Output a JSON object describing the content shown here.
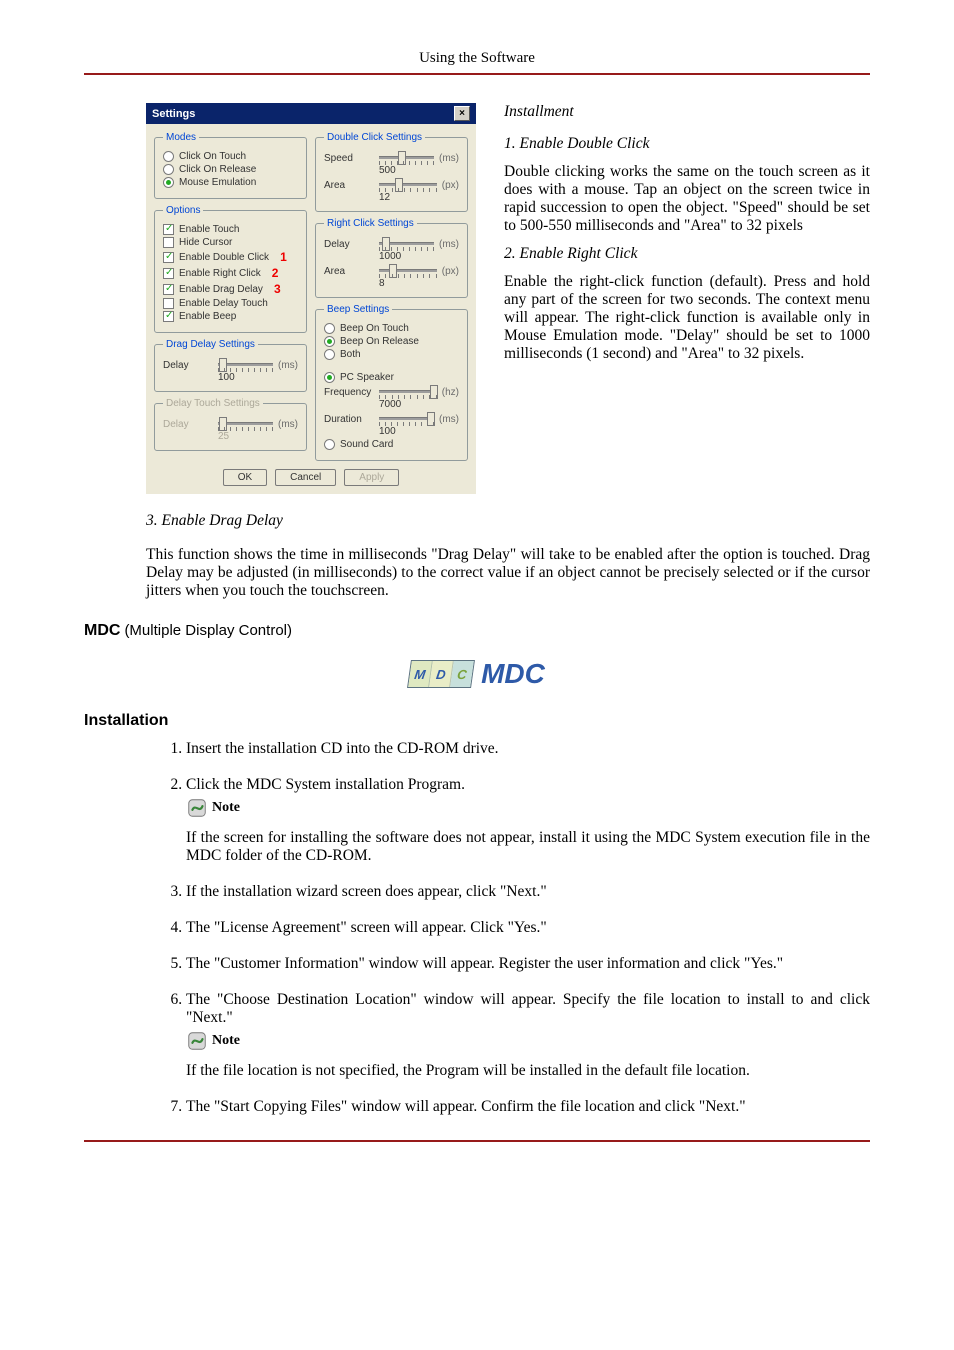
{
  "header": {
    "title": "Using the Software"
  },
  "settings_dialog": {
    "title": "Settings",
    "groups": {
      "modes": {
        "legend": "Modes",
        "click_on_touch": "Click On Touch",
        "click_on_release": "Click On Release",
        "mouse_emulation": "Mouse Emulation"
      },
      "options": {
        "legend": "Options",
        "enable_touch": "Enable Touch",
        "hide_cursor": "Hide Cursor",
        "enable_double_click": "Enable Double Click",
        "enable_right_click": "Enable Right Click",
        "enable_drag_delay": "Enable Drag Delay",
        "enable_delay_touch": "Enable Delay Touch",
        "enable_beep": "Enable Beep",
        "marker1": "1",
        "marker2": "2",
        "marker3": "3"
      },
      "drag_delay": {
        "legend": "Drag Delay Settings",
        "delay_label": "Delay",
        "delay_val": "100",
        "unit": "(ms)"
      },
      "delay_touch": {
        "legend": "Delay Touch Settings",
        "delay_label": "Delay",
        "delay_val": "25",
        "unit": "(ms)"
      },
      "double_click": {
        "legend": "Double Click Settings",
        "speed_label": "Speed",
        "speed_val": "500",
        "speed_unit": "(ms)",
        "area_label": "Area",
        "area_val": "12",
        "area_unit": "(px)"
      },
      "right_click": {
        "legend": "Right Click Settings",
        "delay_label": "Delay",
        "delay_val": "1000",
        "delay_unit": "(ms)",
        "area_label": "Area",
        "area_val": "8",
        "area_unit": "(px)"
      },
      "beep": {
        "legend": "Beep Settings",
        "on_touch": "Beep On Touch",
        "on_release": "Beep On Release",
        "both": "Both",
        "pc_speaker": "PC Speaker",
        "freq_label": "Frequency",
        "freq_val": "7000",
        "freq_unit": "(hz)",
        "dur_label": "Duration",
        "dur_val": "100",
        "dur_unit": "(ms)",
        "sound_card": "Sound Card"
      }
    },
    "buttons": {
      "ok": "OK",
      "cancel": "Cancel",
      "apply": "Apply"
    }
  },
  "right_text": {
    "heading": "Installment",
    "s1_title": "1. Enable Double Click",
    "s1_body": "Double clicking works the same on the touch screen as it does with a mouse. Tap an object on the screen twice in rapid succession to open the object. \"Speed\" should be set to 500-550 milliseconds and \"Area\" to 32 pixels",
    "s2_title": "2. Enable Right Click",
    "s2_body": "Enable the right-click function (default). Press and hold any part of the screen for two seconds. The context menu will appear. The right-click function is available only in Mouse Emulation mode. \"Delay\" should be set to 1000 milliseconds (1 second) and \"Area\" to 32 pixels."
  },
  "drag_delay_section": {
    "title": "3. Enable Drag Delay",
    "body": "This function shows the time in milliseconds \"Drag Delay\" will take to be enabled after the option is touched. Drag Delay may be adjusted (in milliseconds) to the correct value if an object cannot be precisely selected or if the cursor jitters when you touch the touchscreen."
  },
  "mdc_heading": {
    "bold": "MDC",
    "rest": "(Multiple Display Control)"
  },
  "mdc_logo_text": "MDC",
  "installation": {
    "heading": "Installation",
    "items": [
      "Insert the installation CD into the CD-ROM drive.",
      "Click the MDC System installation Program.",
      "If the installation wizard screen does appear, click \"Next.\"",
      "The \"License Agreement\" screen will appear. Click \"Yes.\"",
      "The \"Customer Information\" window will appear. Register the user information and click \"Yes.\"",
      "The \"Choose Destination Location\" window will appear. Specify the file location to install to and click \"Next.\"",
      "The \"Start Copying Files\" window will appear. Confirm the file location and click \"Next.\""
    ],
    "note_label": "Note",
    "note2_body": "If the screen for installing the software does not appear, install it using the MDC System execution file in the MDC folder of the CD-ROM.",
    "note6_body": "If the file location is not specified, the Program will be installed in the default file location."
  }
}
